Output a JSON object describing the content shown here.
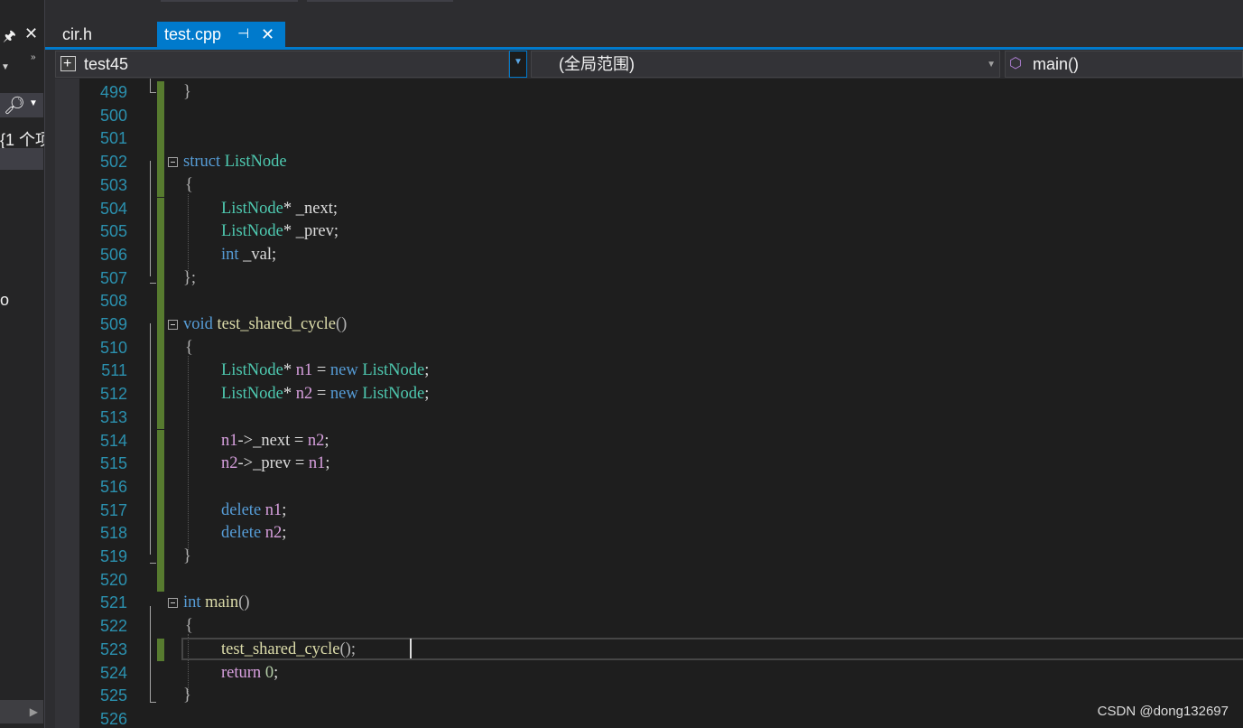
{
  "left_panel": {
    "item_count_text": "{1 个项",
    "stray_text": "o"
  },
  "tabs": [
    {
      "label": "cir.h",
      "active": false
    },
    {
      "label": "test.cpp",
      "active": true
    }
  ],
  "navbar": {
    "project": "test45",
    "scope": "(全局范围)",
    "member": "main()"
  },
  "editor": {
    "lines": [
      {
        "num": "499"
      },
      {
        "num": "500"
      },
      {
        "num": "501"
      },
      {
        "num": "502"
      },
      {
        "num": "503"
      },
      {
        "num": "504"
      },
      {
        "num": "505"
      },
      {
        "num": "506"
      },
      {
        "num": "507"
      },
      {
        "num": "508"
      },
      {
        "num": "509"
      },
      {
        "num": "510"
      },
      {
        "num": "511"
      },
      {
        "num": "512"
      },
      {
        "num": "513"
      },
      {
        "num": "514"
      },
      {
        "num": "515"
      },
      {
        "num": "516"
      },
      {
        "num": "517"
      },
      {
        "num": "518"
      },
      {
        "num": "519"
      },
      {
        "num": "520"
      },
      {
        "num": "521"
      },
      {
        "num": "522"
      },
      {
        "num": "523"
      },
      {
        "num": "524"
      },
      {
        "num": "525"
      },
      {
        "num": "526"
      }
    ],
    "code": {
      "l499": "}",
      "l502_kw": "struct",
      "l502_ty": "ListNode",
      "l503": "{",
      "l504_ty": "ListNode",
      "l504_rest": "* _next;",
      "l505_ty": "ListNode",
      "l505_rest": "* _prev;",
      "l506_kw": "int",
      "l506_rest": "_val;",
      "l507": "};",
      "l509_kw": "void",
      "l509_fn": "test_shared_cycle",
      "l509_p": "()",
      "l510": "{",
      "l511_ty": "ListNode",
      "l511_a": "* ",
      "l511_v": "n1",
      "l511_b": " = ",
      "l511_kw": "new",
      "l511_ty2": "ListNode",
      "l511_e": ";",
      "l512_ty": "ListNode",
      "l512_a": "* ",
      "l512_v": "n2",
      "l512_b": " = ",
      "l512_kw": "new",
      "l512_ty2": "ListNode",
      "l512_e": ";",
      "l514_v": "n1",
      "l514_arrow": "->",
      "l514_m": "_next",
      "l514_eq": " = ",
      "l514_v2": "n2",
      "l514_e": ";",
      "l515_v": "n2",
      "l515_arrow": "->",
      "l515_m": "_prev",
      "l515_eq": " = ",
      "l515_v2": "n1",
      "l515_e": ";",
      "l517_kw": "delete",
      "l517_v": "n1",
      "l517_e": ";",
      "l518_kw": "delete",
      "l518_v": "n2",
      "l518_e": ";",
      "l519": "}",
      "l521_kw": "int",
      "l521_fn": "main",
      "l521_p": "()",
      "l522": "{",
      "l523_fn": "test_shared_cycle",
      "l523_p": "();",
      "l524_kw": "return",
      "l524_nb": "0",
      "l524_e": ";",
      "l525": "}"
    }
  },
  "watermark": "CSDN @dong132697",
  "colors": {
    "accent": "#007acc",
    "line_numbers": "#2b91af",
    "keyword": "#569cd6",
    "type": "#4ec9b0",
    "function": "#dcdcaa",
    "change_bar": "#577b2f",
    "editor_bg": "#1e1e1e"
  },
  "icons": [
    "pin-icon",
    "close-icon",
    "search-icon",
    "project-icon",
    "method-icon",
    "dropdown-arrow-icon"
  ]
}
